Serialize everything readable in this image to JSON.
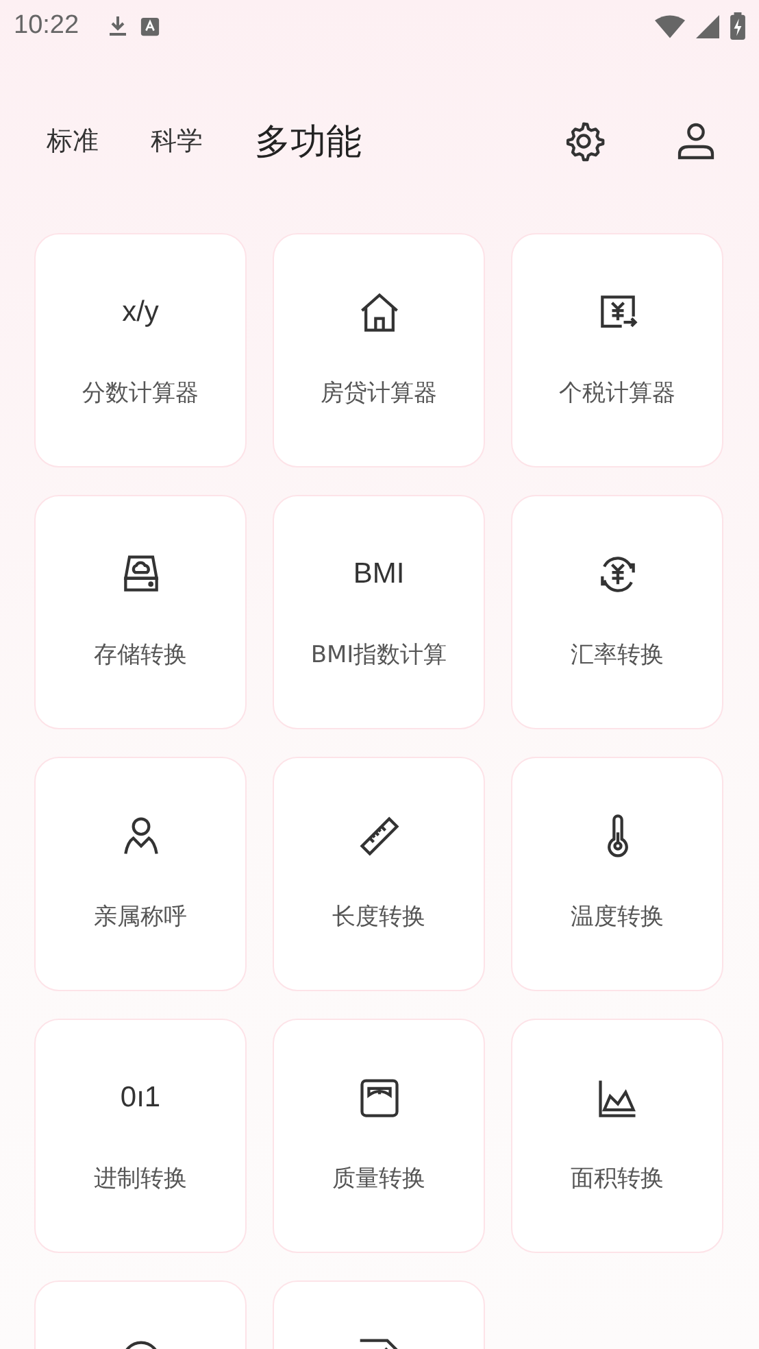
{
  "status_bar": {
    "time": "10:22"
  },
  "tabs": [
    {
      "label": "标准",
      "selected": false
    },
    {
      "label": "科学",
      "selected": false
    },
    {
      "label": "多功能",
      "selected": true
    }
  ],
  "tiles": [
    {
      "kind": "glyph",
      "glyph": "x/y",
      "label": "分数计算器"
    },
    {
      "kind": "icon",
      "label": "房贷计算器"
    },
    {
      "kind": "icon",
      "label": "个税计算器"
    },
    {
      "kind": "icon",
      "label": "存储转换"
    },
    {
      "kind": "glyph",
      "glyph": "BMI",
      "label": "BMI指数计算"
    },
    {
      "kind": "icon",
      "label": "汇率转换"
    },
    {
      "kind": "icon",
      "label": "亲属称呼"
    },
    {
      "kind": "icon",
      "label": "长度转换"
    },
    {
      "kind": "icon",
      "label": "温度转换"
    },
    {
      "kind": "glyph",
      "glyph": "0ı1",
      "label": "进制转换"
    },
    {
      "kind": "icon",
      "label": "质量转换"
    },
    {
      "kind": "icon",
      "label": "面积转换"
    },
    {
      "kind": "icon"
    },
    {
      "kind": "icon"
    }
  ]
}
